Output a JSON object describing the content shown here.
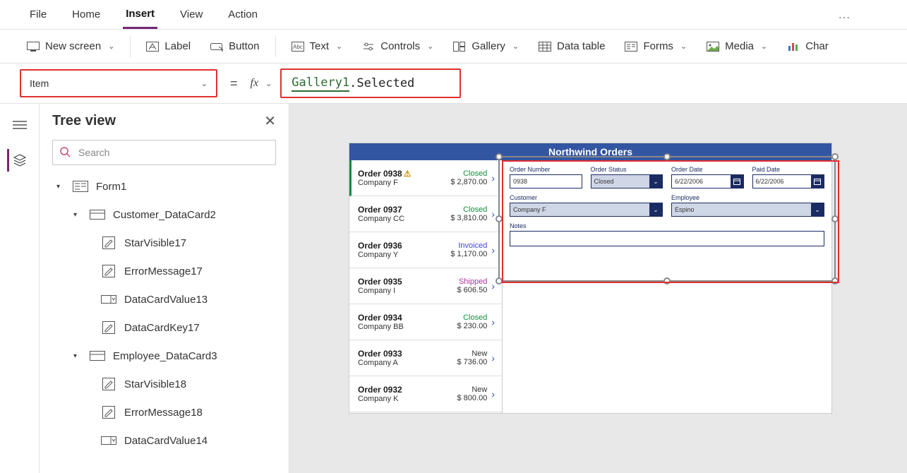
{
  "menu": {
    "file": "File",
    "home": "Home",
    "insert": "Insert",
    "view": "View",
    "action": "Action"
  },
  "toolbar": {
    "new_screen": "New screen",
    "label": "Label",
    "button": "Button",
    "text": "Text",
    "controls": "Controls",
    "gallery": "Gallery",
    "data_table": "Data table",
    "forms": "Forms",
    "media": "Media",
    "chart": "Char"
  },
  "formula": {
    "property": "Item",
    "gallery_ref": "Gallery1",
    "selected": ".Selected"
  },
  "panel": {
    "title": "Tree view",
    "search_placeholder": "Search",
    "nodes": {
      "form1": "Form1",
      "cust": "Customer_DataCard2",
      "svis17": "StarVisible17",
      "err17": "ErrorMessage17",
      "dcv13": "DataCardValue13",
      "dck17": "DataCardKey17",
      "emp": "Employee_DataCard3",
      "svis18": "StarVisible18",
      "err18": "ErrorMessage18",
      "dcv14": "DataCardValue14"
    }
  },
  "app": {
    "title": "Northwind Orders",
    "gallery": [
      {
        "order": "Order 0938",
        "company": "Company F",
        "status": "Closed",
        "status_cls": "closed",
        "amount": "$ 2,870.00",
        "warn": true
      },
      {
        "order": "Order 0937",
        "company": "Company CC",
        "status": "Closed",
        "status_cls": "closed",
        "amount": "$ 3,810.00"
      },
      {
        "order": "Order 0936",
        "company": "Company Y",
        "status": "Invoiced",
        "status_cls": "invoiced",
        "amount": "$ 1,170.00"
      },
      {
        "order": "Order 0935",
        "company": "Company I",
        "status": "Shipped",
        "status_cls": "shipped",
        "amount": "$ 606.50"
      },
      {
        "order": "Order 0934",
        "company": "Company BB",
        "status": "Closed",
        "status_cls": "closed",
        "amount": "$ 230.00"
      },
      {
        "order": "Order 0933",
        "company": "Company A",
        "status": "New",
        "status_cls": "new",
        "amount": "$ 736.00"
      },
      {
        "order": "Order 0932",
        "company": "Company K",
        "status": "New",
        "status_cls": "new",
        "amount": "$ 800.00"
      }
    ],
    "form": {
      "labels": {
        "order_number": "Order Number",
        "order_status": "Order Status",
        "order_date": "Order Date",
        "paid_date": "Paid Date",
        "customer": "Customer",
        "employee": "Employee",
        "notes": "Notes"
      },
      "values": {
        "order_number": "0938",
        "order_status": "Closed",
        "order_date": "6/22/2006",
        "paid_date": "6/22/2006",
        "customer": "Company F",
        "employee": "Espino"
      }
    }
  }
}
